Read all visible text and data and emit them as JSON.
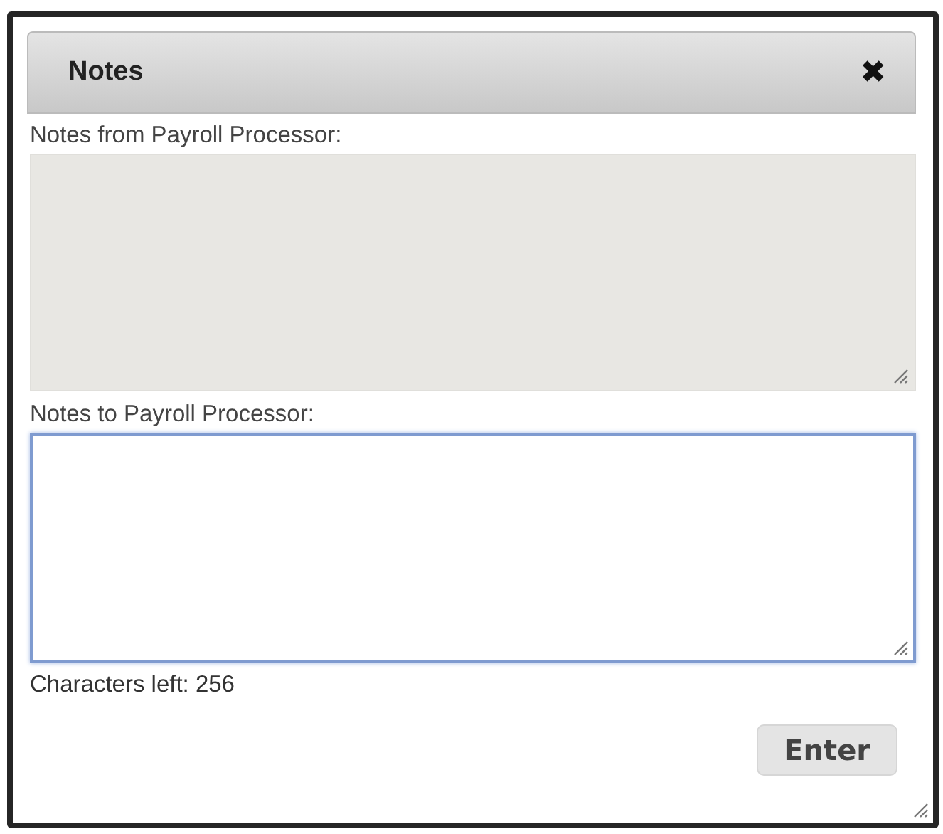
{
  "dialog": {
    "title": "Notes",
    "close": "✖"
  },
  "fields": [
    {
      "label": "Notes from Payroll Processor:",
      "readonly": true,
      "focused": false
    },
    {
      "label": "Notes to Payroll Processor:",
      "readonly": false,
      "focused": true
    }
  ],
  "counter": "Characters left: 256",
  "buttons": [
    "Enter"
  ]
}
